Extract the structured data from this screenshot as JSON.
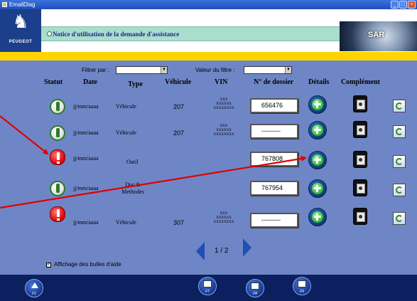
{
  "window": {
    "title": "EmailDiag"
  },
  "header": {
    "brand": "PEUGEOT",
    "notice_text": "Notice d'utilisation de la demande d'assistance",
    "logo_text": "SAR"
  },
  "filters": {
    "filter_by_label": "Filtrer par :",
    "filter_by_value": "",
    "filter_value_label": "Valeur du filtre :",
    "filter_value_value": ""
  },
  "table": {
    "columns": [
      "Statut",
      "Date",
      "Type",
      "Véhicule",
      "VIN",
      "N° de dossier",
      "Détails",
      "Complément"
    ],
    "rows": [
      {
        "status": "info",
        "date": "jj/mm/aaaa",
        "type": "Véhicule",
        "vehicle": "207",
        "vin": [
          "XXX",
          "XXXXXX",
          "XXXXXXXX"
        ],
        "dossier": "656476"
      },
      {
        "status": "info",
        "date": "jj/mm/aaaa",
        "type": "Véhicule",
        "vehicle": "207",
        "vin": [
          "XXX",
          "XXXXXX",
          "XXXXXXXX"
        ],
        "dossier": "---------"
      },
      {
        "status": "error",
        "date": "jj/mm/aaaa",
        "type": "Outil",
        "vehicle": "",
        "vin": [
          "",
          "",
          ""
        ],
        "dossier": "767808"
      },
      {
        "status": "info",
        "date": "jj/mm/aaaa",
        "type": "Doc & Methodes",
        "vehicle": "",
        "vin": [
          "",
          "",
          ""
        ],
        "dossier": "767954"
      },
      {
        "status": "error",
        "date": "jj/mm/aaaa",
        "type": "Véhicule",
        "vehicle": "307",
        "vin": [
          "XXX",
          "XXXXXX",
          "XXXXXXXX"
        ],
        "dossier": "---------"
      }
    ]
  },
  "pagination": {
    "label": "1 / 2"
  },
  "bubble_help": {
    "label": "Affichage des bulles d'aide",
    "checked": true
  },
  "function_keys": [
    "F1",
    "F7",
    "F8",
    "F9"
  ],
  "colors": {
    "main_bg": "#6f86c6",
    "accent_yellow": "#ffd400",
    "bottom_bar": "#0c2060",
    "annotation_red": "#e00000"
  }
}
